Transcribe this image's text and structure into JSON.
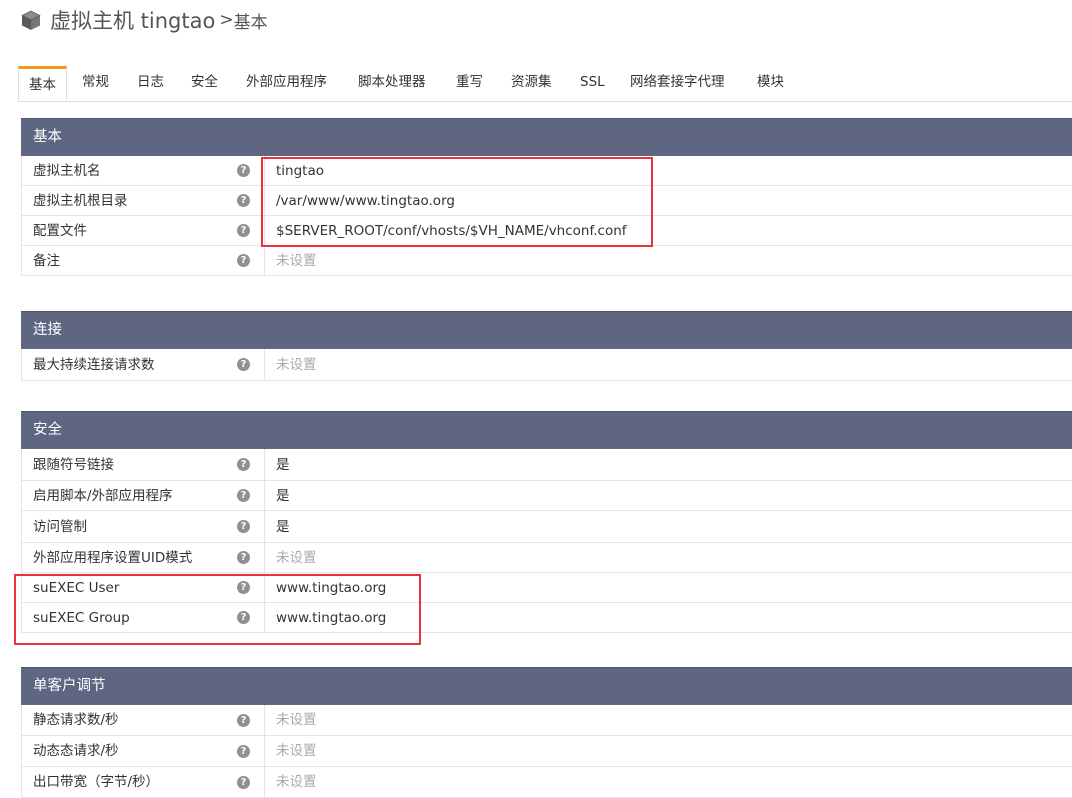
{
  "header": {
    "icon": "cube-icon",
    "title": "虚拟主机 tingtao",
    "separator": ">",
    "subtitle": "基本"
  },
  "tabs": [
    {
      "label": "基本",
      "active": true
    },
    {
      "label": "常规"
    },
    {
      "label": "日志"
    },
    {
      "label": "安全"
    },
    {
      "label": "外部应用程序"
    },
    {
      "label": "脚本处理器"
    },
    {
      "label": "重写"
    },
    {
      "label": "资源集"
    },
    {
      "label": "SSL"
    },
    {
      "label": "网络套接字代理"
    },
    {
      "label": "模块"
    }
  ],
  "help_glyph": "?",
  "sections": {
    "basic": {
      "title": "基本",
      "rows": [
        {
          "label": "虚拟主机名",
          "value": "tingtao"
        },
        {
          "label": "虚拟主机根目录",
          "value": "/var/www/www.tingtao.org"
        },
        {
          "label": "配置文件",
          "value": "$SERVER_ROOT/conf/vhosts/$VH_NAME/vhconf.conf"
        },
        {
          "label": "备注",
          "value": "未设置"
        }
      ]
    },
    "connection": {
      "title": "连接",
      "rows": [
        {
          "label": "最大持续连接请求数",
          "value": "未设置"
        }
      ]
    },
    "security": {
      "title": "安全",
      "rows": [
        {
          "label": "跟随符号链接",
          "value": "是"
        },
        {
          "label": "启用脚本/外部应用程序",
          "value": "是"
        },
        {
          "label": "访问管制",
          "value": "是"
        },
        {
          "label": "外部应用程序设置UID模式",
          "value": "未设置"
        },
        {
          "label": "suEXEC User",
          "value": "www.tingtao.org"
        },
        {
          "label": "suEXEC Group",
          "value": "www.tingtao.org"
        }
      ]
    },
    "per_client": {
      "title": "单客户调节",
      "rows": [
        {
          "label": "静态请求数/秒",
          "value": "未设置"
        },
        {
          "label": "动态态请求/秒",
          "value": "未设置"
        },
        {
          "label": "出口带宽（字节/秒）",
          "value": "未设置"
        }
      ]
    }
  },
  "colors": {
    "section_header": "#5e6682",
    "active_tab_accent": "#f39c12",
    "highlight": "#e8333a",
    "unset_text": "#aaaaaa"
  }
}
